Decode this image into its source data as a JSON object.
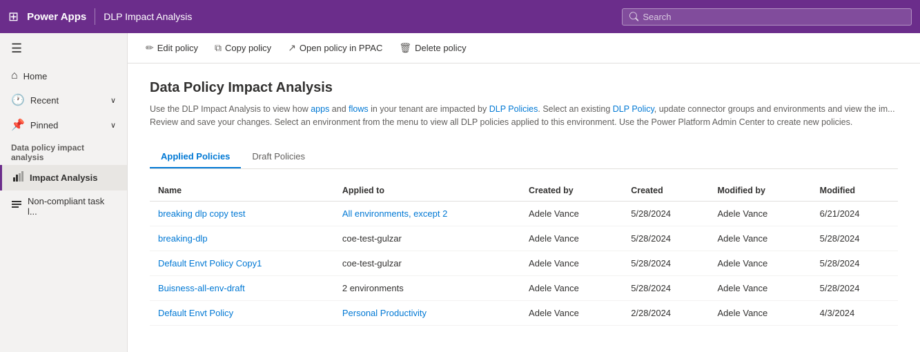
{
  "topnav": {
    "brand": "Power Apps",
    "separator": "|",
    "title": "DLP Impact Analysis",
    "search_placeholder": "Search"
  },
  "toolbar": {
    "buttons": [
      {
        "id": "edit-policy",
        "icon": "✏️",
        "label": "Edit policy"
      },
      {
        "id": "copy-policy",
        "icon": "📄",
        "label": "Copy policy"
      },
      {
        "id": "open-ppac",
        "icon": "🔗",
        "label": "Open policy in PPAC"
      },
      {
        "id": "delete-policy",
        "icon": "🗑️",
        "label": "Delete policy"
      }
    ]
  },
  "sidebar": {
    "hamburger": "☰",
    "nav_items": [
      {
        "id": "home",
        "icon": "⌂",
        "label": "Home",
        "chevron": false
      },
      {
        "id": "recent",
        "icon": "🕐",
        "label": "Recent",
        "chevron": true
      },
      {
        "id": "pinned",
        "icon": "📌",
        "label": "Pinned",
        "chevron": true
      }
    ],
    "section_label": "Data policy impact analysis",
    "sub_items": [
      {
        "id": "impact-analysis",
        "icon": "📊",
        "label": "Impact Analysis",
        "active": true
      },
      {
        "id": "non-compliant",
        "icon": "📋",
        "label": "Non-compliant task l...",
        "active": false
      }
    ]
  },
  "page": {
    "title": "Data Policy Impact Analysis",
    "description": "Use the DLP Impact Analysis to view how apps and flows in your tenant are impacted by DLP Policies. Select an existing DLP Policy, update connector groups and environments and view the im... Review and save your changes. Select an environment from the menu to view all DLP policies applied to this environment. Use the Power Platform Admin Center to create new policies."
  },
  "tabs": [
    {
      "id": "applied",
      "label": "Applied Policies",
      "active": true
    },
    {
      "id": "draft",
      "label": "Draft Policies",
      "active": false
    }
  ],
  "table": {
    "columns": [
      {
        "id": "name",
        "label": "Name"
      },
      {
        "id": "applied_to",
        "label": "Applied to"
      },
      {
        "id": "created_by",
        "label": "Created by"
      },
      {
        "id": "created",
        "label": "Created"
      },
      {
        "id": "modified_by",
        "label": "Modified by"
      },
      {
        "id": "modified",
        "label": "Modified"
      }
    ],
    "rows": [
      {
        "name": "breaking dlp copy test",
        "applied_to": "All environments, except 2",
        "created_by": "Adele Vance",
        "created": "5/28/2024",
        "modified_by": "Adele Vance",
        "modified": "6/21/2024",
        "name_link": true,
        "applied_link": true
      },
      {
        "name": "breaking-dlp",
        "applied_to": "coe-test-gulzar",
        "created_by": "Adele Vance",
        "created": "5/28/2024",
        "modified_by": "Adele Vance",
        "modified": "5/28/2024",
        "name_link": true,
        "applied_link": false
      },
      {
        "name": "Default Envt Policy Copy1",
        "applied_to": "coe-test-gulzar",
        "created_by": "Adele Vance",
        "created": "5/28/2024",
        "modified_by": "Adele Vance",
        "modified": "5/28/2024",
        "name_link": true,
        "applied_link": false
      },
      {
        "name": "Buisness-all-env-draft",
        "applied_to": "2 environments",
        "created_by": "Adele Vance",
        "created": "5/28/2024",
        "modified_by": "Adele Vance",
        "modified": "5/28/2024",
        "name_link": true,
        "applied_link": false
      },
      {
        "name": "Default Envt Policy",
        "applied_to": "Personal Productivity",
        "created_by": "Adele Vance",
        "created": "2/28/2024",
        "modified_by": "Adele Vance",
        "modified": "4/3/2024",
        "name_link": true,
        "applied_link": true
      }
    ]
  }
}
